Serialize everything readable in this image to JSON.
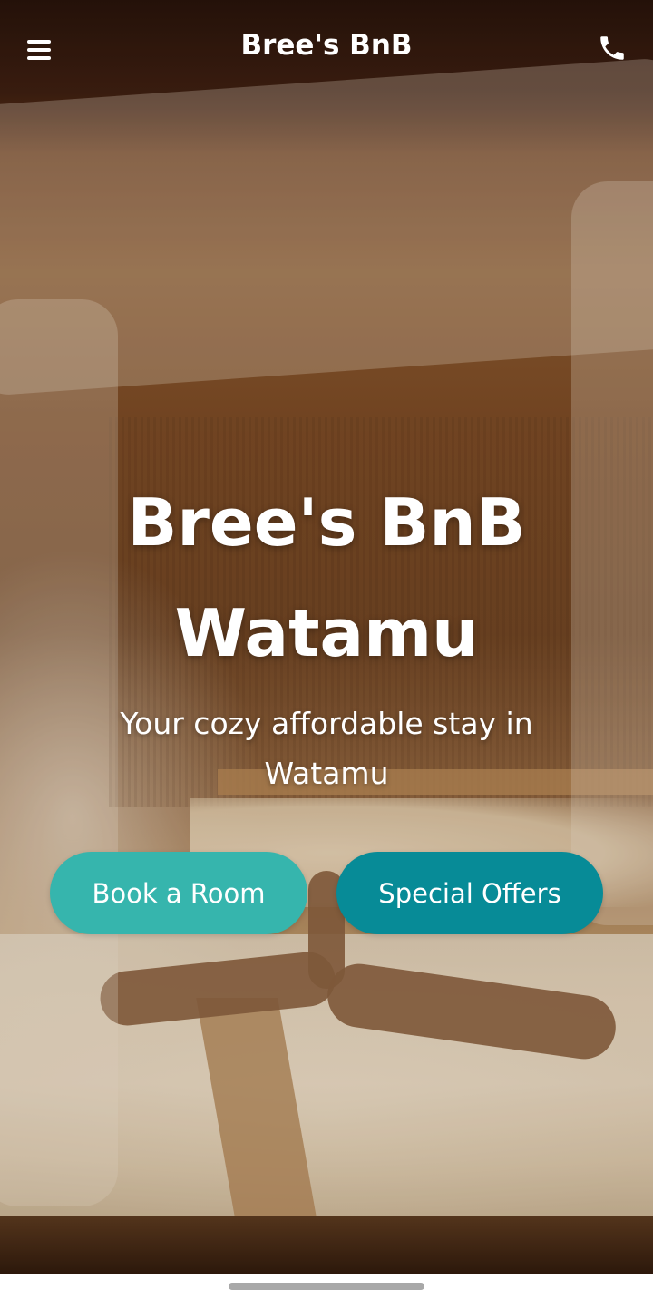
{
  "header": {
    "title": "Bree's BnB",
    "menu_icon": "hamburger-menu-icon",
    "phone_icon": "phone-icon"
  },
  "hero": {
    "title_line1": "Bree's BnB",
    "title_line2": "Watamu",
    "subtitle_line1": "Your cozy affordable stay in",
    "subtitle_line2": "Watamu",
    "book_button": "Book a Room",
    "offers_button": "Special Offers"
  },
  "colors": {
    "book_button": "#36b5ad",
    "offers_button": "#078b97",
    "text": "#ffffff"
  }
}
